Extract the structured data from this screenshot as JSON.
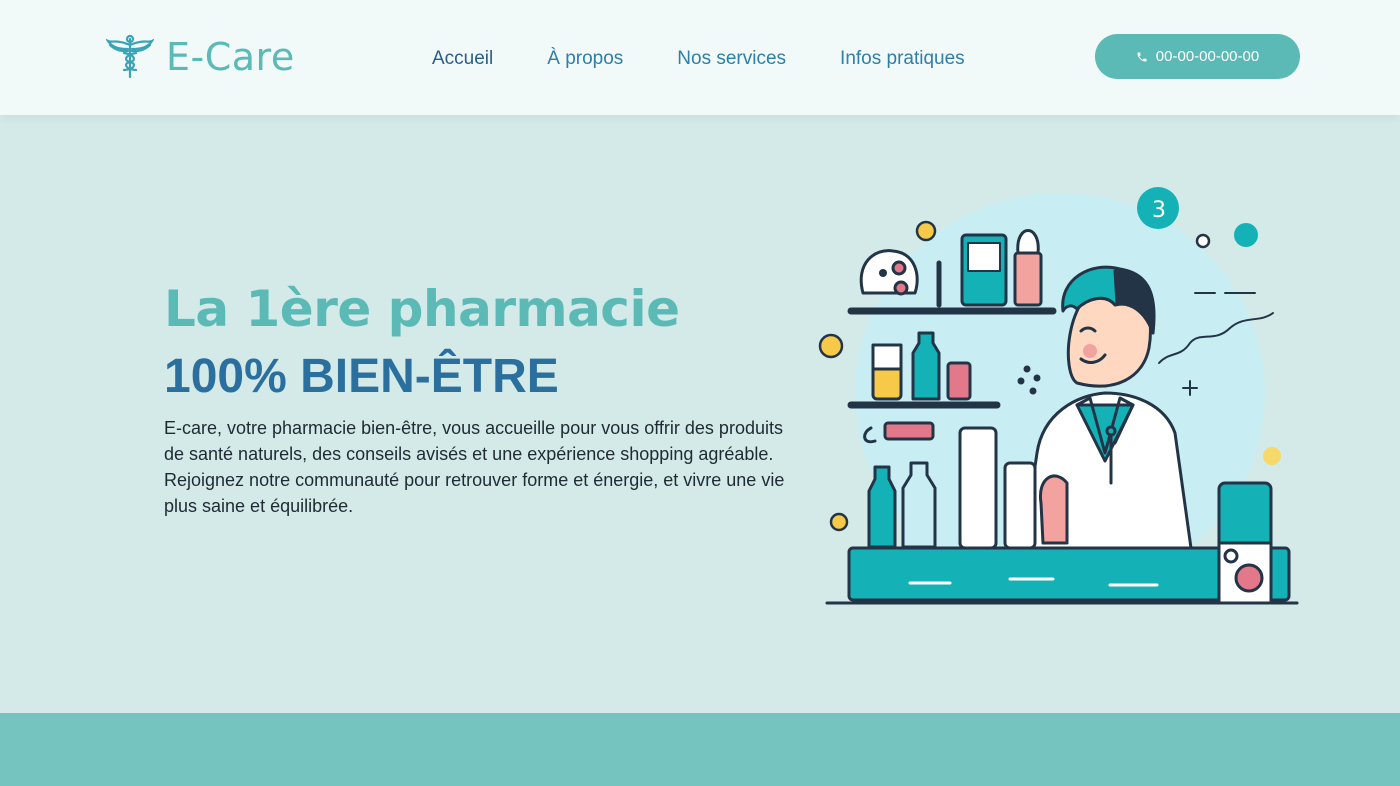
{
  "brand": {
    "name": "E-Care",
    "logo_icon": "caduceus-icon",
    "color": "#5bb9b6"
  },
  "nav": {
    "items": [
      {
        "label": "Accueil"
      },
      {
        "label": "À propos"
      },
      {
        "label": "Nos services"
      },
      {
        "label": "Infos pratiques"
      }
    ]
  },
  "phone": {
    "label": "00-00-00-00-00",
    "icon": "phone-icon"
  },
  "hero": {
    "title": "La 1ère pharmacie",
    "subtitle": "100% BIEN-ÊTRE",
    "text": "E-care, votre pharmacie bien-être, vous accueille pour vous offrir des produits de santé naturels, des conseils avisés et une expérience shopping agréable. Rejoignez notre communauté pour retrouver forme et énergie, et vivre une vie plus saine et équilibrée.",
    "illustration": "pharmacist-illustration"
  },
  "colors": {
    "accent": "#5bb9b6",
    "navy": "#2b6f9e",
    "header_bg": "#f1f9f9",
    "hero_bg": "#d3eae8",
    "band": "#76c4c0"
  }
}
